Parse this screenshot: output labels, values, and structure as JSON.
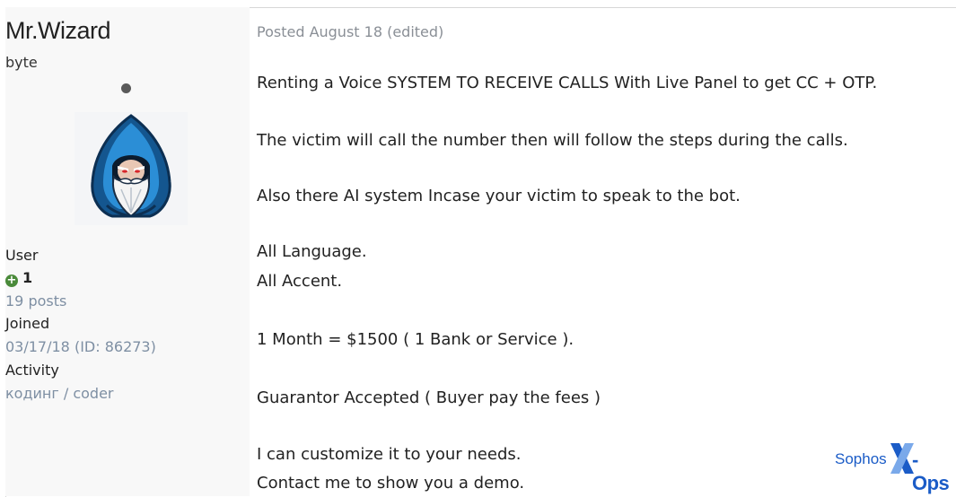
{
  "author": {
    "username": "Mr.Wizard",
    "title": "byte",
    "group": "User",
    "reputation": "1",
    "posts": "19 posts",
    "joined_label": "Joined",
    "joined_value": "03/17/18 (ID: 86273)",
    "activity_label": "Activity",
    "activity_value": "кодинг / coder"
  },
  "post": {
    "posted": "Posted August 18 (edited)",
    "lines": [
      "Renting a Voice SYSTEM TO RECEIVE CALLS With Live Panel to get CC + OTP.",
      "The victim will call the number then will follow the steps during the calls.",
      "Also there AI system Incase your victim to speak to the bot.",
      "All Language.",
      "All Accent.",
      "1 Month = $1500 ( 1 Bank or Service ).",
      "Guarantor Accepted ( Buyer pay the fees )",
      "I can customize it to your needs.",
      "Contact me to show you a demo."
    ]
  },
  "watermark": {
    "brand": "Sophos",
    "suffix": "-Ops"
  },
  "icons": {
    "status": "status-dot-icon",
    "reputation": "plus-circle-icon",
    "avatar": "wizard-avatar-icon",
    "brand_mark": "x-logo-icon"
  },
  "colors": {
    "muted_text": "#7e8fa3",
    "reputation_green": "#4a8a3a",
    "sophos_blue": "#1b5cc7"
  }
}
